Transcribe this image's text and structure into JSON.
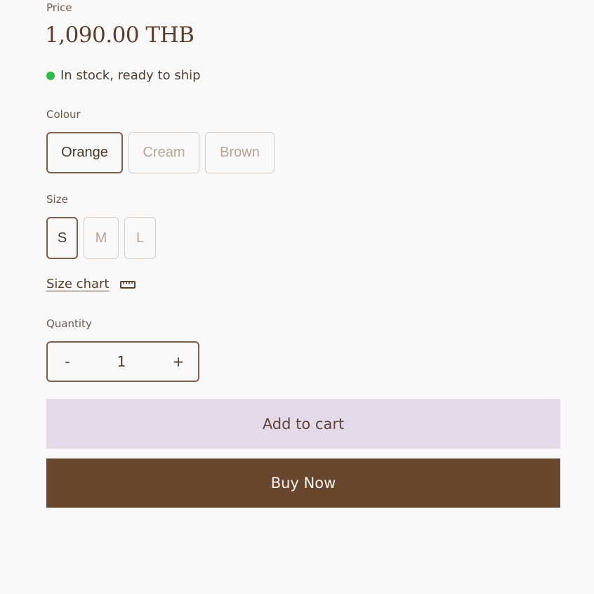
{
  "price": {
    "label": "Price",
    "value": "1,090.00 THB"
  },
  "stock": {
    "text": "In stock, ready to ship",
    "status_color": "#31b84f"
  },
  "colour": {
    "label": "Colour",
    "options": [
      "Orange",
      "Cream",
      "Brown"
    ],
    "selected": "Orange"
  },
  "size": {
    "label": "Size",
    "options": [
      "S",
      "M",
      "L"
    ],
    "selected": "S"
  },
  "size_chart": {
    "label": "Size chart",
    "icon": "ruler-icon"
  },
  "quantity": {
    "label": "Quantity",
    "decrement": "-",
    "value": "1",
    "increment": "+"
  },
  "actions": {
    "add_to_cart": "Add to cart",
    "buy_now": "Buy Now"
  },
  "colors": {
    "brand_brown": "#68472e",
    "add_to_cart_bg": "#e3d9e8"
  }
}
